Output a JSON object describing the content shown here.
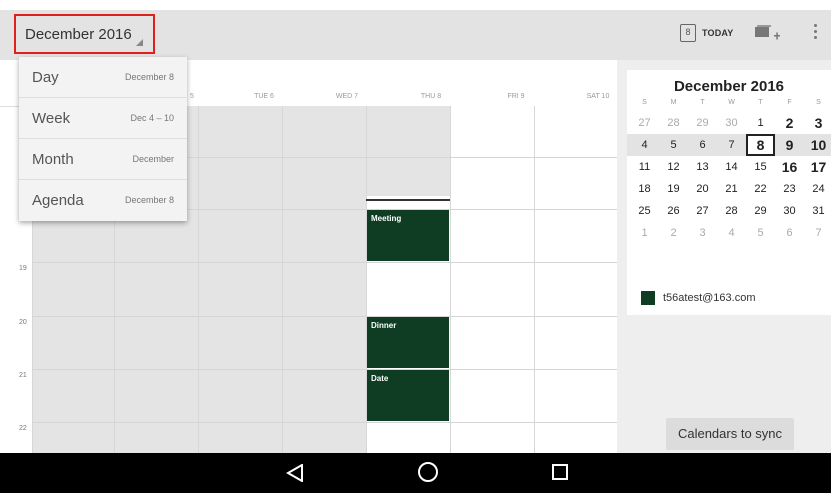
{
  "topbar": {
    "month_label": "December 2016",
    "today_icon_text": "8",
    "today_label": "TODAY",
    "icons": [
      "today-icon",
      "add-event-icon",
      "more-vert-icon"
    ]
  },
  "dropdown": {
    "items": [
      {
        "name": "Day",
        "sub": "December 8"
      },
      {
        "name": "Week",
        "sub": "Dec 4 – 10"
      },
      {
        "name": "Month",
        "sub": "December"
      },
      {
        "name": "Agenda",
        "sub": "December 8"
      }
    ]
  },
  "week_view": {
    "day_headers": [
      "5",
      "TUE 6",
      "WED 7",
      "THU 8",
      "FRI 9",
      "SAT 10"
    ],
    "hours": [
      "19",
      "20",
      "21",
      "22"
    ],
    "events": [
      {
        "title": "Meeting"
      },
      {
        "title": "Dinner"
      },
      {
        "title": "Date"
      }
    ]
  },
  "mini_calendar": {
    "title": "December 2016",
    "dow": [
      "S",
      "M",
      "T",
      "W",
      "T",
      "F",
      "S"
    ],
    "weeks": [
      [
        "27",
        "28",
        "29",
        "30",
        "1",
        "2",
        "3"
      ],
      [
        "4",
        "5",
        "6",
        "7",
        "8",
        "9",
        "10"
      ],
      [
        "11",
        "12",
        "13",
        "14",
        "15",
        "16",
        "17"
      ],
      [
        "18",
        "19",
        "20",
        "21",
        "22",
        "23",
        "24"
      ],
      [
        "25",
        "26",
        "27",
        "28",
        "29",
        "30",
        "31"
      ],
      [
        "1",
        "2",
        "3",
        "4",
        "5",
        "6",
        "7"
      ]
    ]
  },
  "account": {
    "email": "t56atest@163.com",
    "color": "#0e3d23"
  },
  "sync_button": "Calendars to sync",
  "colors": {
    "event": "#0e3d23",
    "highlight": "#e0201c"
  }
}
